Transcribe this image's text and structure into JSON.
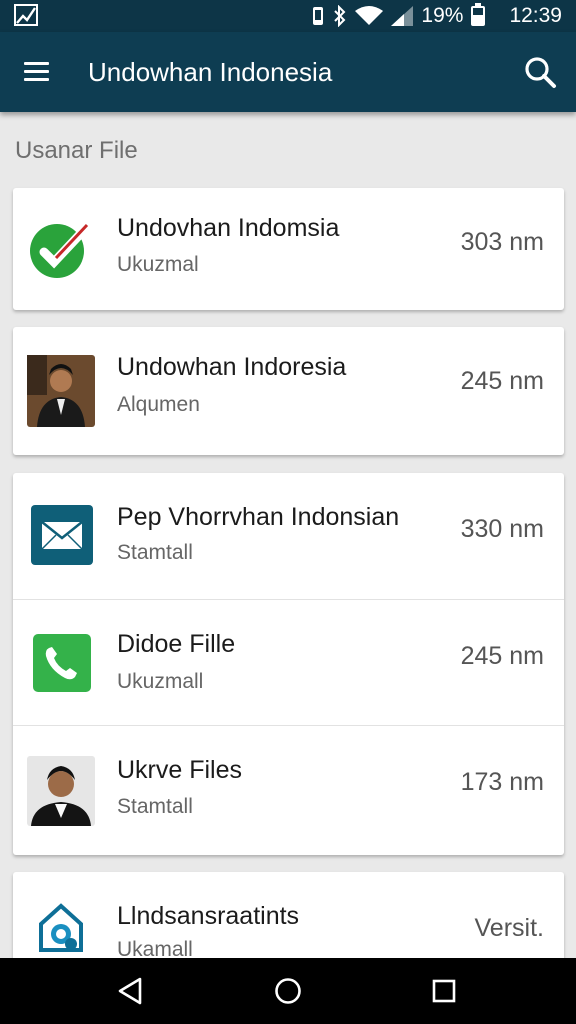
{
  "status_bar": {
    "battery_percent": "19%",
    "time": "12:39",
    "icons": [
      "image-icon",
      "vibrate-icon",
      "bluetooth-icon",
      "wifi-icon",
      "signal-icon",
      "battery-icon"
    ]
  },
  "app_bar": {
    "title": "Undowhan Indonesia",
    "menu_icon": "menu-icon",
    "search_icon": "search-icon"
  },
  "section": {
    "header": "Usanar File"
  },
  "items": [
    {
      "title": "Undovhan Indomsia",
      "subtitle": "Ukuzmal",
      "value": "303 nm",
      "icon": "check-icon",
      "accent": "#2aa33b"
    },
    {
      "title": "Undowhan Indoresia",
      "subtitle": "Alqumen",
      "value": "245 nm",
      "icon": "person-photo-icon"
    },
    {
      "title": "Pep Vhorrvhan Indonsian",
      "subtitle": "Stamtall",
      "value": "330 nm",
      "icon": "mail-icon",
      "accent": "#0f5f78"
    },
    {
      "title": "Didoe Fille",
      "subtitle": "Ukuzmall",
      "value": "245 nm",
      "icon": "phone-icon",
      "accent": "#34b24a"
    },
    {
      "title": "Ukrve Files",
      "subtitle": "Stamtall",
      "value": "173 nm",
      "icon": "person-photo-icon"
    },
    {
      "title": "Llndsansraatints",
      "subtitle": "Ukamall",
      "value": "Versit.",
      "icon": "house-badge-icon",
      "accent": "#0e6f97"
    }
  ],
  "colors": {
    "app_bar": "#0e3d52",
    "status_bar": "#0d3547",
    "background": "#e9e9e9",
    "nav_bar": "#000000"
  }
}
